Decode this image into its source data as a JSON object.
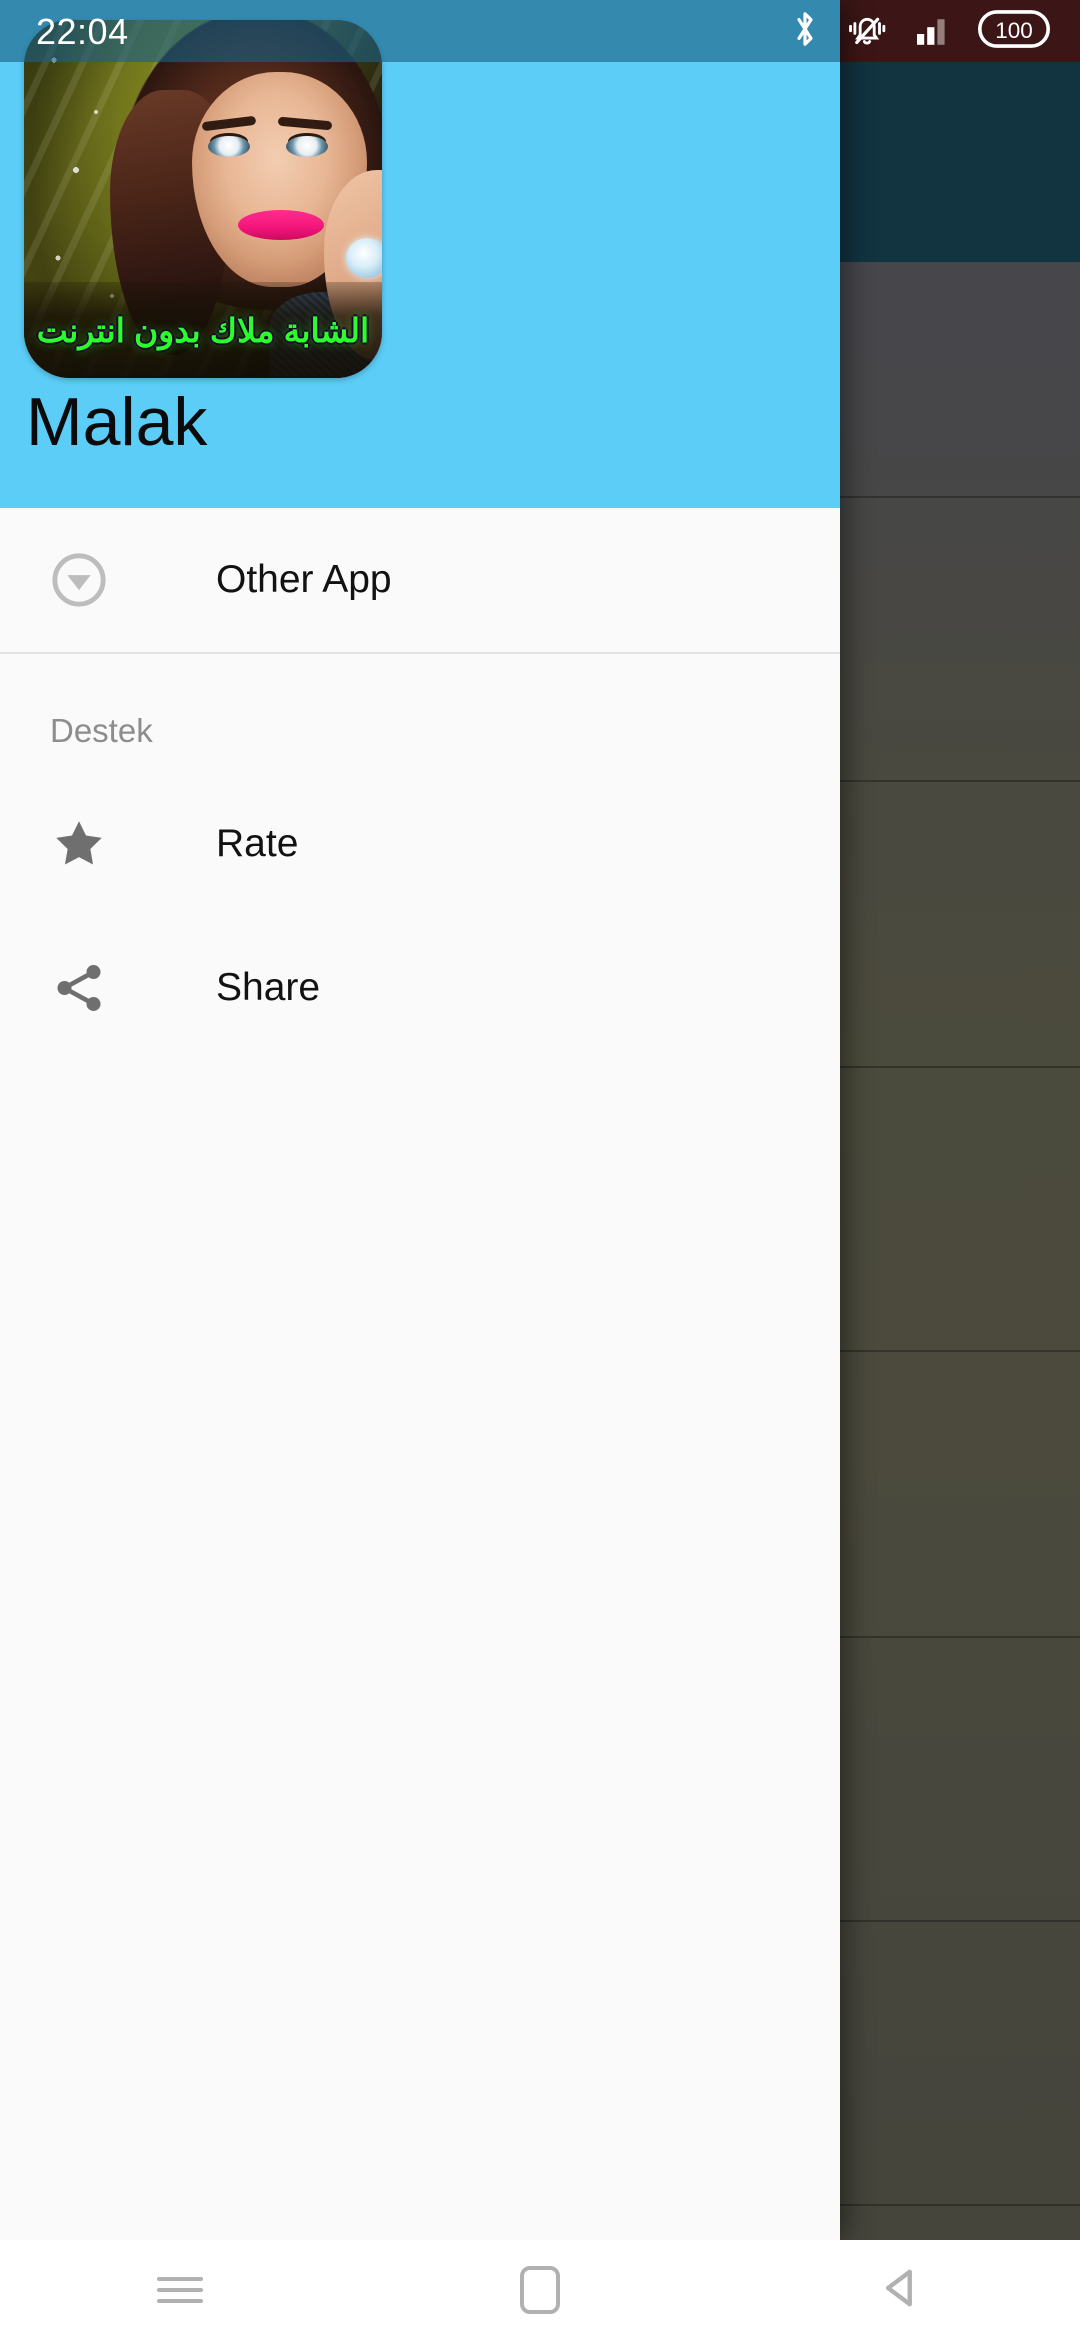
{
  "status_bar": {
    "clock": "22:04",
    "icons": [
      {
        "name": "bluetooth-icon",
        "label": "Bluetooth"
      },
      {
        "name": "ringer-vibrate-muted-icon",
        "label": "Silent / vibrate"
      },
      {
        "name": "cellular-signal-icon",
        "label": "Signal"
      },
      {
        "name": "battery-icon",
        "label": "Battery"
      }
    ],
    "battery_level": "100",
    "tint_color": "#5c2322"
  },
  "drawer": {
    "header": {
      "app_title": "Malak",
      "icon_banner_text": "الشابة ملاك بدون انترنت",
      "icon_name": "app-icon-malak",
      "background_color": "#5ccdf7",
      "title_color": "#0b0b0b",
      "banner_text_color": "#2bff2b"
    },
    "items": [
      {
        "label": "Other App",
        "icon": "circle-down-arrow-icon"
      }
    ],
    "section": {
      "title": "Destek",
      "items": [
        {
          "label": "Rate",
          "icon": "star-icon"
        },
        {
          "label": "Share",
          "icon": "share-icon"
        }
      ]
    }
  },
  "background_app": {
    "toolbar_color": "#1d4f63",
    "list_background_color": "#6f6e60",
    "scrim_color": "rgba(0,0,0,0.35)"
  },
  "navigation_bar": {
    "buttons": [
      {
        "name": "recents-button",
        "icon": "hamburger-icon"
      },
      {
        "name": "home-button",
        "icon": "rounded-square-icon"
      },
      {
        "name": "back-button",
        "icon": "triangle-left-icon"
      }
    ],
    "background_color": "#ffffff",
    "icon_color": "#b1b1b1"
  }
}
